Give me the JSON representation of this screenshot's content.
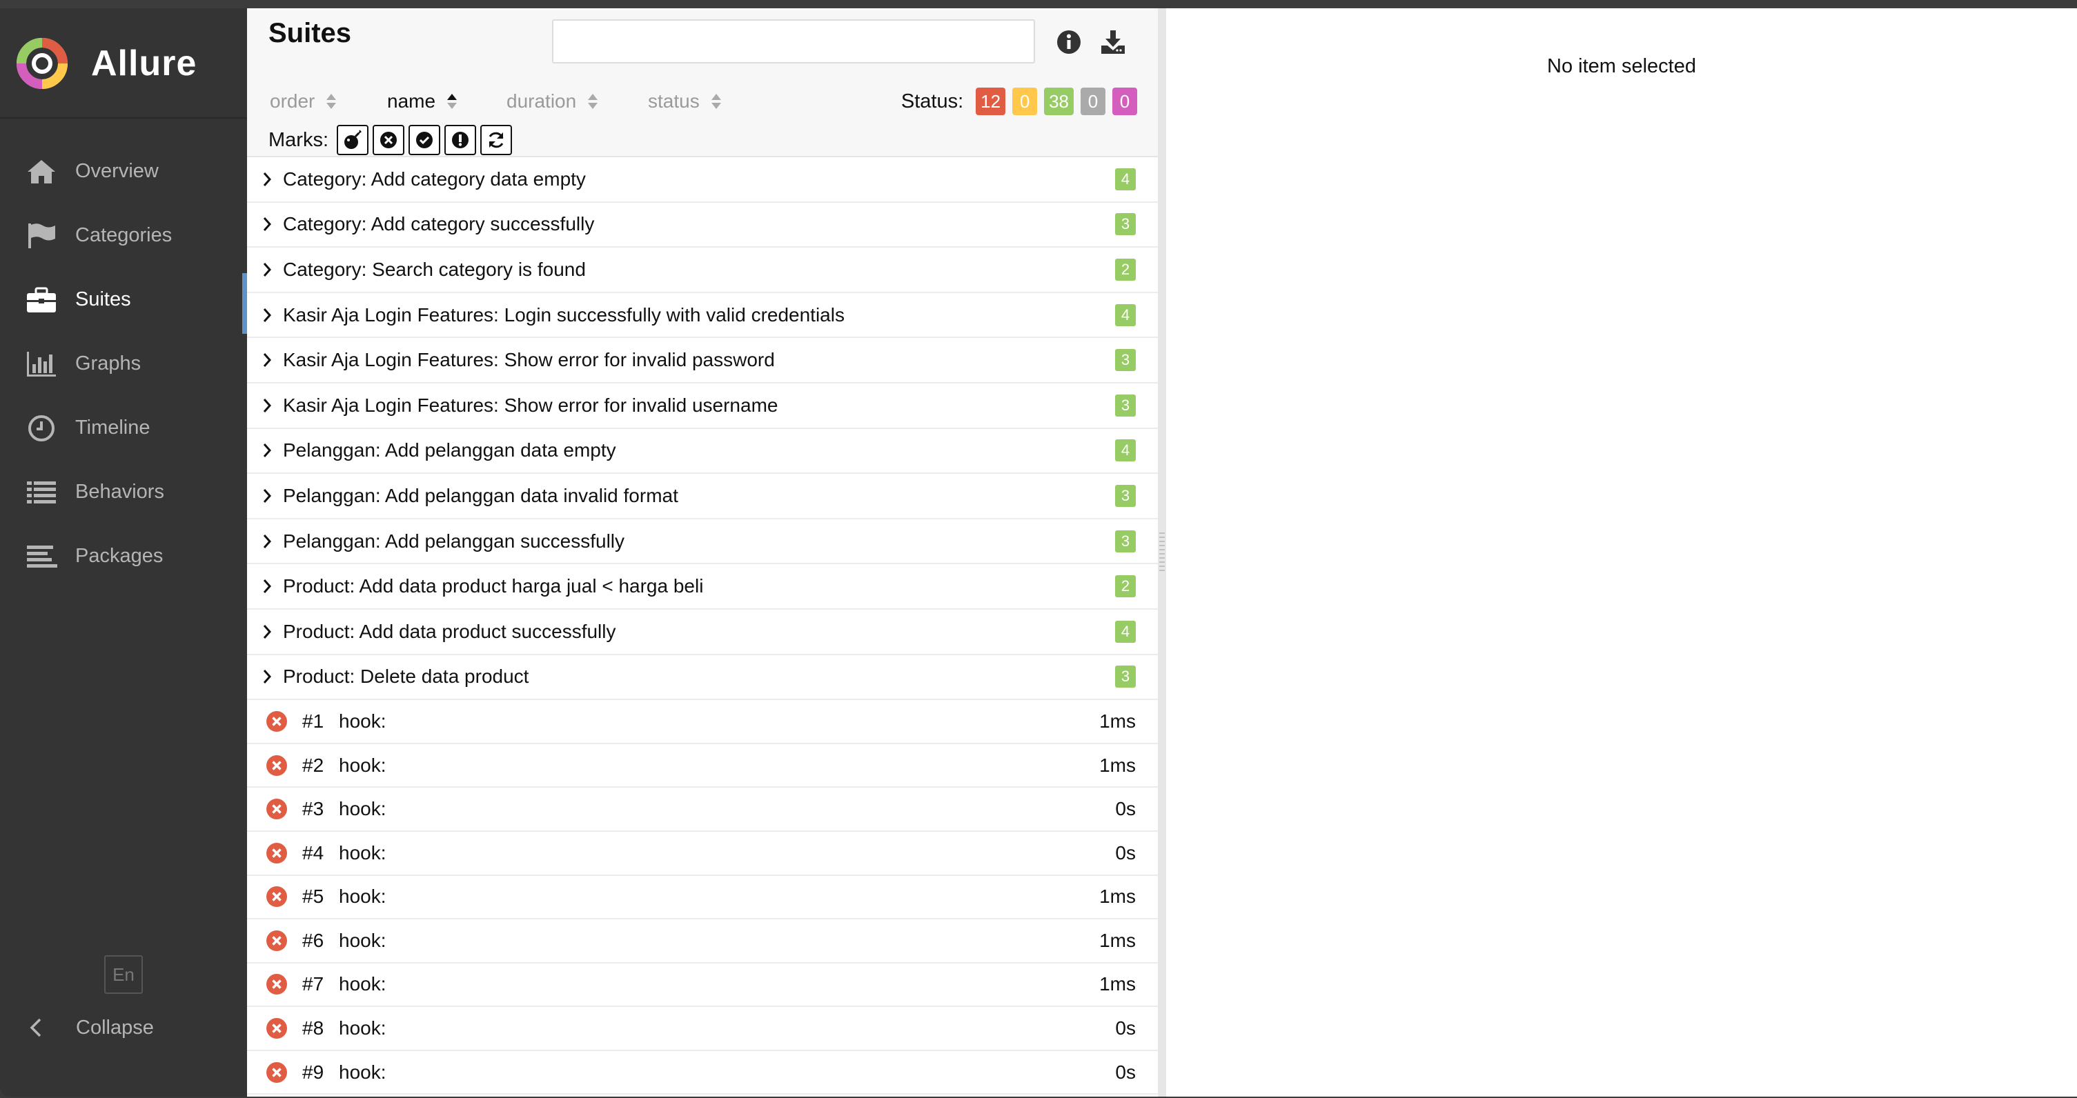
{
  "app": {
    "name": "Allure"
  },
  "sidebar": {
    "items": [
      {
        "label": "Overview",
        "icon": "home-icon",
        "active": false
      },
      {
        "label": "Categories",
        "icon": "flag-icon",
        "active": false
      },
      {
        "label": "Suites",
        "icon": "briefcase-icon",
        "active": true
      },
      {
        "label": "Graphs",
        "icon": "bar-chart-icon",
        "active": false
      },
      {
        "label": "Timeline",
        "icon": "clock-icon",
        "active": false
      },
      {
        "label": "Behaviors",
        "icon": "list-icon",
        "active": false
      },
      {
        "label": "Packages",
        "icon": "align-left-icon",
        "active": false
      }
    ],
    "language": "En",
    "collapse_label": "Collapse"
  },
  "suites": {
    "title": "Suites",
    "search": {
      "value": "",
      "placeholder": ""
    },
    "sorters": {
      "order": "order",
      "name": "name",
      "duration": "duration",
      "status": "status"
    },
    "status_label": "Status:",
    "status_counts": {
      "failed": "12",
      "broken": "0",
      "passed": "38",
      "skipped": "0",
      "unknown": "0"
    },
    "marks_label": "Marks:",
    "groups": [
      {
        "name": "Category: Add category data empty",
        "count": "4"
      },
      {
        "name": "Category: Add category successfully",
        "count": "3"
      },
      {
        "name": "Category: Search category is found",
        "count": "2"
      },
      {
        "name": "Kasir Aja Login Features: Login successfully with valid credentials",
        "count": "4"
      },
      {
        "name": "Kasir Aja Login Features: Show error for invalid password",
        "count": "3"
      },
      {
        "name": "Kasir Aja Login Features: Show error for invalid username",
        "count": "3"
      },
      {
        "name": "Pelanggan: Add pelanggan data empty",
        "count": "4"
      },
      {
        "name": "Pelanggan: Add pelanggan data invalid format",
        "count": "3"
      },
      {
        "name": "Pelanggan: Add pelanggan successfully",
        "count": "3"
      },
      {
        "name": "Product: Add data product harga jual < harga beli",
        "count": "2"
      },
      {
        "name": "Product: Add data product successfully",
        "count": "4"
      },
      {
        "name": "Product: Delete data product",
        "count": "3"
      }
    ],
    "tests": [
      {
        "num": "#1",
        "name": "hook:",
        "duration": "1ms"
      },
      {
        "num": "#2",
        "name": "hook:",
        "duration": "1ms"
      },
      {
        "num": "#3",
        "name": "hook:",
        "duration": "0s"
      },
      {
        "num": "#4",
        "name": "hook:",
        "duration": "0s"
      },
      {
        "num": "#5",
        "name": "hook:",
        "duration": "1ms"
      },
      {
        "num": "#6",
        "name": "hook:",
        "duration": "1ms"
      },
      {
        "num": "#7",
        "name": "hook:",
        "duration": "1ms"
      },
      {
        "num": "#8",
        "name": "hook:",
        "duration": "0s"
      },
      {
        "num": "#9",
        "name": "hook:",
        "duration": "0s"
      }
    ]
  },
  "detail": {
    "empty_message": "No item selected"
  },
  "colors": {
    "failed": "#e05d44",
    "broken": "#ffc84a",
    "passed": "#97cc64",
    "skipped": "#aaaaaa",
    "unknown": "#d35ebe",
    "accent": "#5e92c9"
  }
}
